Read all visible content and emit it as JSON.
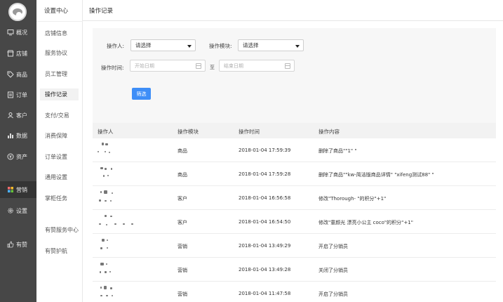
{
  "nav": {
    "items": [
      {
        "label": "概况",
        "icon": "monitor-icon"
      },
      {
        "label": "店铺",
        "icon": "store-icon"
      },
      {
        "label": "商品",
        "icon": "tag-icon"
      },
      {
        "label": "订单",
        "icon": "order-icon"
      },
      {
        "label": "客户",
        "icon": "user-icon"
      },
      {
        "label": "数据",
        "icon": "bar-chart-icon"
      },
      {
        "label": "资产",
        "icon": "yen-icon"
      },
      {
        "label": "营销",
        "icon": "grid-icon"
      },
      {
        "label": "设置",
        "icon": "gear-icon"
      },
      {
        "label": "有赞",
        "icon": "thumbs-up-icon"
      }
    ]
  },
  "subnav": {
    "title": "设置中心",
    "items": [
      "店铺信息",
      "服务协议",
      "员工管理",
      "操作记录",
      "支付/交易",
      "消费保障",
      "订单设置",
      "通用设置",
      "掌柜任务",
      "有赞服务中心",
      "有赞护航"
    ]
  },
  "page": {
    "title": "操作记录"
  },
  "filter": {
    "operator_label": "操作人:",
    "operator_value": "请选择",
    "module_label": "操作模块:",
    "module_value": "请选择",
    "time_label": "操作时间:",
    "start_placeholder": "开始日期",
    "to_label": "至",
    "end_placeholder": "结束日期",
    "button": "筛选"
  },
  "table": {
    "headers": [
      "操作人",
      "操作模块",
      "操作时间",
      "操作内容"
    ],
    "rows": [
      {
        "module": "商品",
        "time": "2018-01-04 17:59:39",
        "content": "删除了商品\"\"1\" \""
      },
      {
        "module": "商品",
        "time": "2018-01-04 17:59:28",
        "content": "删除了商品\"\"kw-简洁版商品详情\" \"xifeng测试88\" \""
      },
      {
        "module": "客户",
        "time": "2018-01-04 16:56:58",
        "content": "修改\"Thorough- \"的积分\"+1\""
      },
      {
        "module": "客户",
        "time": "2018-01-04 16:54:50",
        "content": "修改\"童颜光 漂亮小公主 coco\"的积分\"+1\""
      },
      {
        "module": "营销",
        "time": "2018-01-04 13:49:29",
        "content": "开启了分销员"
      },
      {
        "module": "营销",
        "time": "2018-01-04 13:49:28",
        "content": "关闭了分销员"
      },
      {
        "module": "营销",
        "time": "2018-01-04 11:47:58",
        "content": "开启了分销员"
      }
    ]
  },
  "colors": {
    "sidebar": "#474747",
    "primary": "#3e8ef7",
    "table_header": "#f2f2f2"
  }
}
